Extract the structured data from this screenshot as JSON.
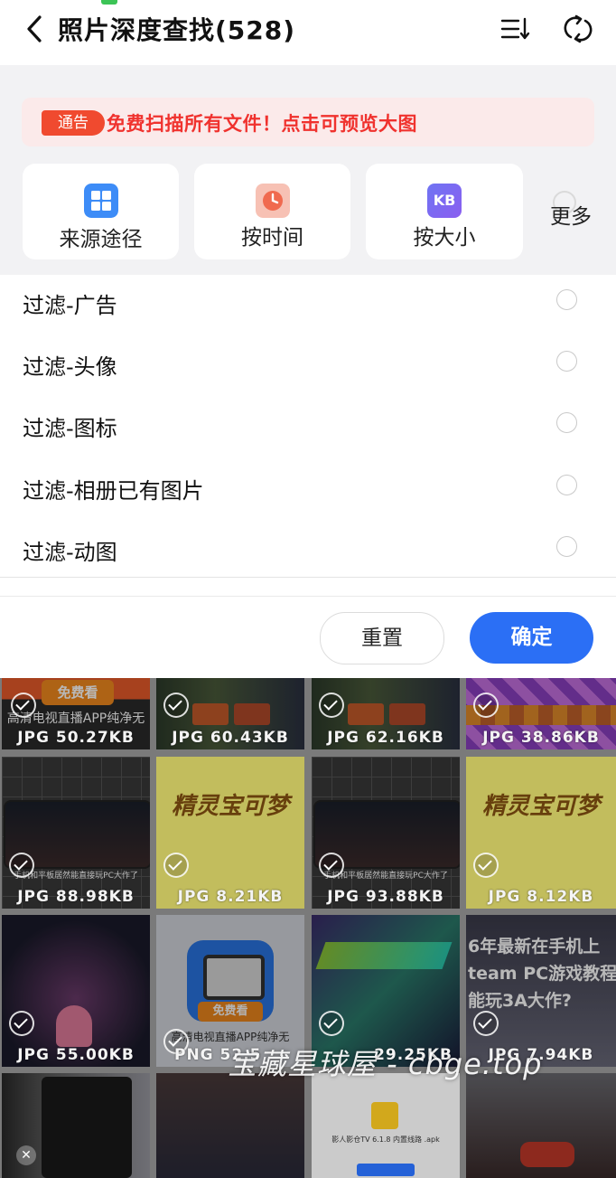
{
  "header": {
    "title": "照片深度查找(528)",
    "back_icon": "back-chevron-icon",
    "sort_icon": "sort-icon",
    "refresh_icon": "refresh-icon"
  },
  "notice": {
    "tag": "通告",
    "text": "免费扫描所有文件！点击可预览大图"
  },
  "filters": {
    "source_label": "来源途径",
    "time_label": "按时间",
    "size_label": "按大小",
    "size_icon_text": "KB",
    "more_label": "更多"
  },
  "options": [
    {
      "label": "过滤-广告"
    },
    {
      "label": "过滤-头像"
    },
    {
      "label": "过滤-图标"
    },
    {
      "label": "过滤-相册已有图片"
    },
    {
      "label": "过滤-动图"
    }
  ],
  "actions": {
    "reset_label": "重置",
    "confirm_label": "确定"
  },
  "grid": {
    "tiles": [
      {
        "label": "JPG 50.27KB",
        "banner": "免费看",
        "caption": "高清电视直播APP纯净无"
      },
      {
        "label": "JPG 60.43KB"
      },
      {
        "label": "JPG 62.16KB"
      },
      {
        "label": "JPG 38.86KB"
      },
      {
        "label": "JPG 88.98KB",
        "caption": "手机和平板居然能直接玩PC大作了"
      },
      {
        "label": "JPG 8.21KB",
        "banner": "精灵宝可梦"
      },
      {
        "label": "JPG 93.88KB",
        "caption": "手机和平板居然能直接玩PC大作了"
      },
      {
        "label": "JPG 8.12KB",
        "banner": "精灵宝可梦"
      },
      {
        "label": "JPG 55.00KB"
      },
      {
        "label": "PNG 52.5",
        "banner": "免费看",
        "caption": "高清电视直播APP纯净无"
      },
      {
        "label": "29.25KB"
      },
      {
        "label": "JPG 7.94KB",
        "caption": "6年最新在手机上 team PC游戏教程 能玩3A大作?"
      },
      {
        "label": ""
      },
      {
        "label": ""
      },
      {
        "label": "",
        "caption": "影人影仓TV 6.1.8 内置线路 .apk"
      },
      {
        "label": ""
      }
    ]
  },
  "watermark": "宝藏星球屋 - cbge.top",
  "colors": {
    "accent": "#2b6ff5",
    "notice_red": "#f0322e",
    "notice_bg": "#fbeaea",
    "panel_bg": "#f2f2f4"
  }
}
